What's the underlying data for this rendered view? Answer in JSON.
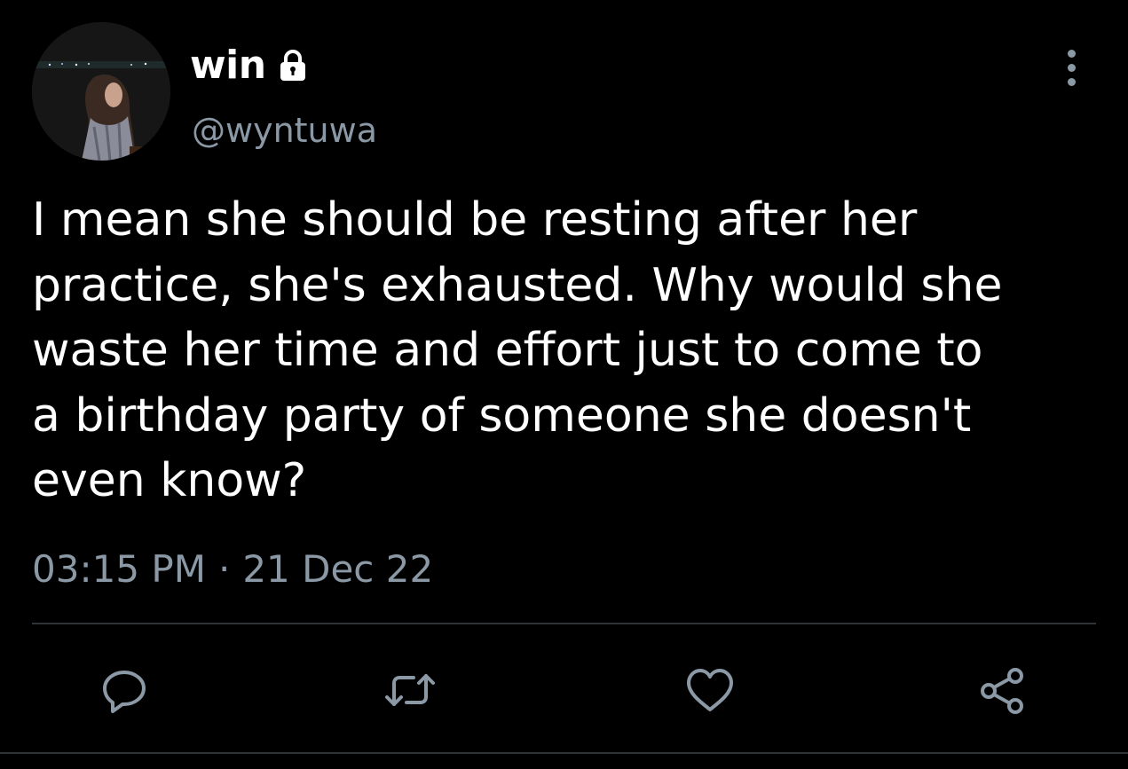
{
  "tweet": {
    "author": {
      "display_name": "win",
      "handle": "@wyntuwa",
      "protected_icon": "lock-icon",
      "avatar": "avatar"
    },
    "text": "I mean she should be resting after her\npractice, she's exhausted. Why would she\nwaste her time and effort just to come to\na birthday party of someone she doesn't\neven know?",
    "time": "03:15 PM",
    "separator": "·",
    "date": "21 Dec 22",
    "more_icon": "more-vertical-icon"
  },
  "actions": [
    {
      "name": "reply",
      "icon": "reply-icon"
    },
    {
      "name": "retweet",
      "icon": "retweet-icon"
    },
    {
      "name": "like",
      "icon": "heart-icon"
    },
    {
      "name": "share",
      "icon": "share-icon"
    }
  ],
  "colors": {
    "background": "#000000",
    "text": "#ffffff",
    "secondary": "#8b98a5",
    "divider": "#2f3336"
  }
}
